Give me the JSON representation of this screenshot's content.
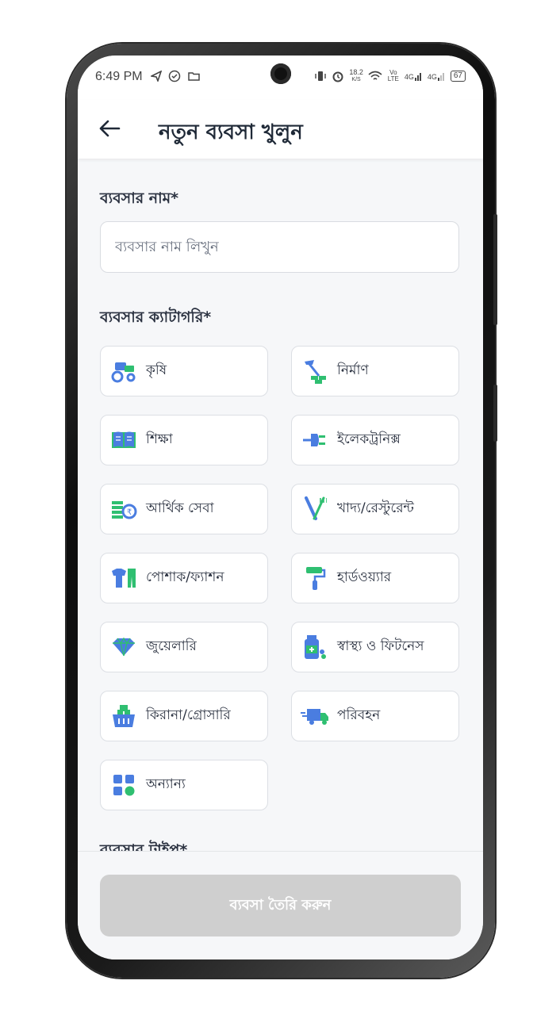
{
  "status_bar": {
    "time": "6:49 PM",
    "left_icons": [
      "send-icon",
      "check-circle-icon",
      "folder-icon"
    ],
    "speed": "18.2",
    "speed_unit": "K/S",
    "volte": "Vo LTE",
    "net1": "4G",
    "net2": "4G",
    "battery": "67"
  },
  "header": {
    "title": "নতুন ব্যবসা খুলুন",
    "back_icon": "arrow-left-icon"
  },
  "form": {
    "name_label": "ব্যবসার নাম*",
    "name_placeholder": "ব্যবসার নাম লিখুন",
    "name_value": "",
    "category_label": "ব্যবসার ক্যাটাগরি*",
    "type_label": "ব্যবসার টাইপ*"
  },
  "categories": [
    {
      "label": "কৃষি",
      "icon": "tractor-icon"
    },
    {
      "label": "নির্মাণ",
      "icon": "construction-icon"
    },
    {
      "label": "শিক্ষা",
      "icon": "book-icon"
    },
    {
      "label": "ইলেকট্রনিক্স",
      "icon": "plug-icon"
    },
    {
      "label": "আর্থিক সেবা",
      "icon": "money-icon"
    },
    {
      "label": "খাদ্য/রেস্টুরেন্ট",
      "icon": "fork-knife-icon"
    },
    {
      "label": "পোশাক/ফ্যাশন",
      "icon": "clothing-icon"
    },
    {
      "label": "হার্ডওয়্যার",
      "icon": "paint-roller-icon"
    },
    {
      "label": "জুয়েলারি",
      "icon": "diamond-icon"
    },
    {
      "label": "স্বাস্থ্য ও ফিটনেস",
      "icon": "medicine-icon"
    },
    {
      "label": "কিরানা/গ্রোসারি",
      "icon": "grocery-basket-icon"
    },
    {
      "label": "পরিবহন",
      "icon": "truck-icon"
    },
    {
      "label": "অন্যান্য",
      "icon": "grid-shapes-icon"
    }
  ],
  "footer": {
    "create_button": "ব্যবসা তৈরি করুন"
  },
  "colors": {
    "icon_blue": "#4a7de0",
    "icon_green": "#2fbf71",
    "button_disabled": "#cfcfcf"
  }
}
